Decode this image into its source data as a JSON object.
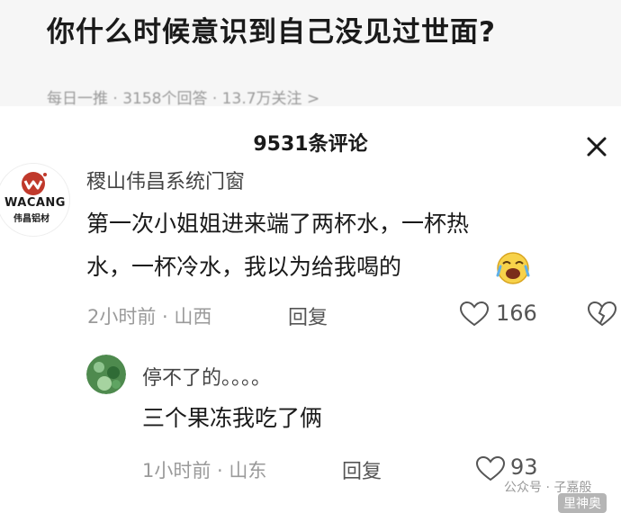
{
  "question": {
    "title": "你什么时候意识到自己没见过世面?",
    "meta": "每日一推 · 3158个回答 · 13.7万关注 >"
  },
  "comments_sheet": {
    "title": "9531条评论",
    "close_icon": "close-icon"
  },
  "comment": {
    "avatar_logo": "WACANG",
    "avatar_logo_sub": "伟昌铝材",
    "author": "稷山伟昌系统门窗",
    "text_line1": "第一次小姐姐进来端了两杯水，一杯热",
    "text_line2": "水，一杯冷水，我以为给我喝的",
    "emoji": "laughing-crying-emoji",
    "time_location": "2小时前 · 山西",
    "reply_label": "回复",
    "likes": "166"
  },
  "reply": {
    "author": "停不了的。。。。",
    "text": "三个果冻我吃了俩",
    "time_location": "1小时前 · 山东",
    "reply_label": "回复",
    "likes": "93"
  },
  "watermarks": {
    "left": "公众号 · 子嘉般",
    "right": "里神奥"
  },
  "colors": {
    "brand_logo": "#c0392b",
    "text_primary": "#1a1a1a",
    "text_secondary": "#9a9a9a"
  }
}
